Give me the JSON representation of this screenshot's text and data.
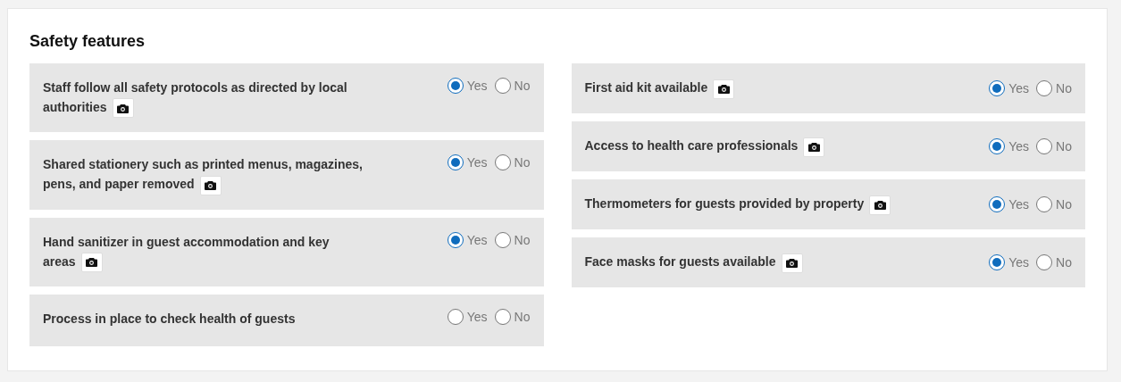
{
  "title": "Safety features",
  "columns": [
    {
      "items": [
        {
          "label": "Staff follow all safety protocols as directed by local authorities",
          "photo": true,
          "options": [
            {
              "label": "Yes",
              "selected": true
            },
            {
              "label": "No",
              "selected": false
            }
          ]
        },
        {
          "label": "Shared stationery such as printed menus, magazines, pens, and paper removed",
          "photo": true,
          "options": [
            {
              "label": "Yes",
              "selected": true
            },
            {
              "label": "No",
              "selected": false
            }
          ]
        },
        {
          "label": "Hand sanitizer in guest accommodation and key areas",
          "photo": true,
          "options": [
            {
              "label": "Yes",
              "selected": true
            },
            {
              "label": "No",
              "selected": false
            }
          ]
        },
        {
          "label": "Process in place to check health of guests",
          "photo": false,
          "options": [
            {
              "label": "Yes",
              "selected": false
            },
            {
              "label": "No",
              "selected": false
            }
          ]
        }
      ]
    },
    {
      "items": [
        {
          "label": "First aid kit available",
          "photo": true,
          "options": [
            {
              "label": "Yes",
              "selected": true
            },
            {
              "label": "No",
              "selected": false
            }
          ]
        },
        {
          "label": "Access to health care professionals",
          "photo": true,
          "options": [
            {
              "label": "Yes",
              "selected": true
            },
            {
              "label": "No",
              "selected": false
            }
          ]
        },
        {
          "label": "Thermometers for guests provided by property",
          "photo": true,
          "options": [
            {
              "label": "Yes",
              "selected": true
            },
            {
              "label": "No",
              "selected": false
            }
          ]
        },
        {
          "label": "Face masks for guests available",
          "photo": true,
          "options": [
            {
              "label": "Yes",
              "selected": true
            },
            {
              "label": "No",
              "selected": false
            }
          ]
        }
      ]
    }
  ]
}
